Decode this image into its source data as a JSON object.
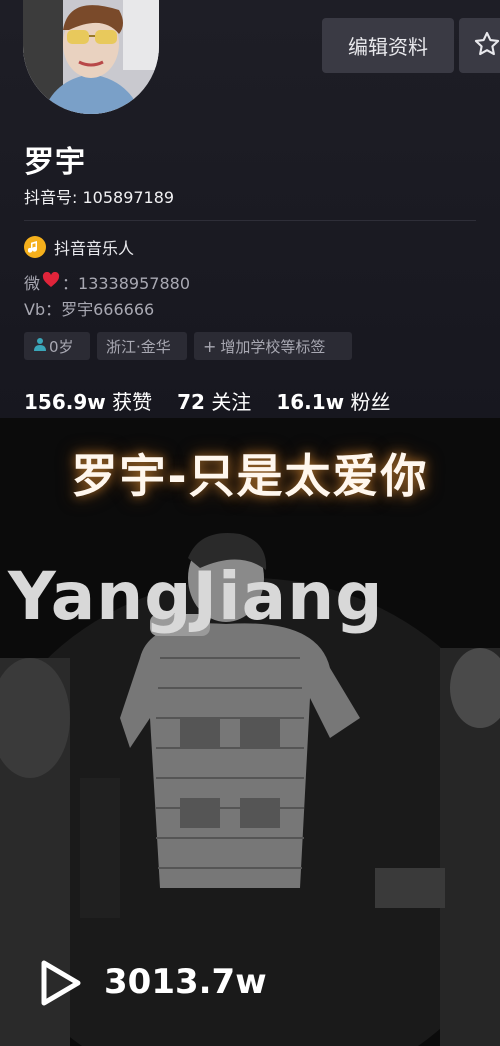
{
  "profile": {
    "name": "罗宇",
    "douyin_id": "抖音号: 105897189",
    "edit_button_label": "编辑资料",
    "verification": "抖音音乐人",
    "bio_line1_prefix": "微",
    "bio_line1_number": "：13338957880",
    "bio_line2": "Vb：罗宇666666",
    "tags": {
      "age": "0岁",
      "location": "浙江·金华",
      "add_school": "增加学校等标签"
    },
    "stats": {
      "likes_num": "156.9w",
      "likes_label": "获赞",
      "following_num": "72",
      "following_label": "关注",
      "followers_num": "16.1w",
      "followers_label": "粉丝"
    }
  },
  "video": {
    "title_overlay": "罗宇-只是太爱你",
    "watermark": "YangJiang",
    "play_count": "3013.7w"
  },
  "icons": {
    "star": "star-icon",
    "music_badge": "music-note-icon",
    "play": "play-icon",
    "person": "person-icon",
    "heart": "heart-icon"
  },
  "colors": {
    "background": "#15151d",
    "button_bg": "#3a3a44",
    "badge_gold": "#f5b01c",
    "heart_red": "#e0243a",
    "person_teal": "#3aa6b9"
  }
}
